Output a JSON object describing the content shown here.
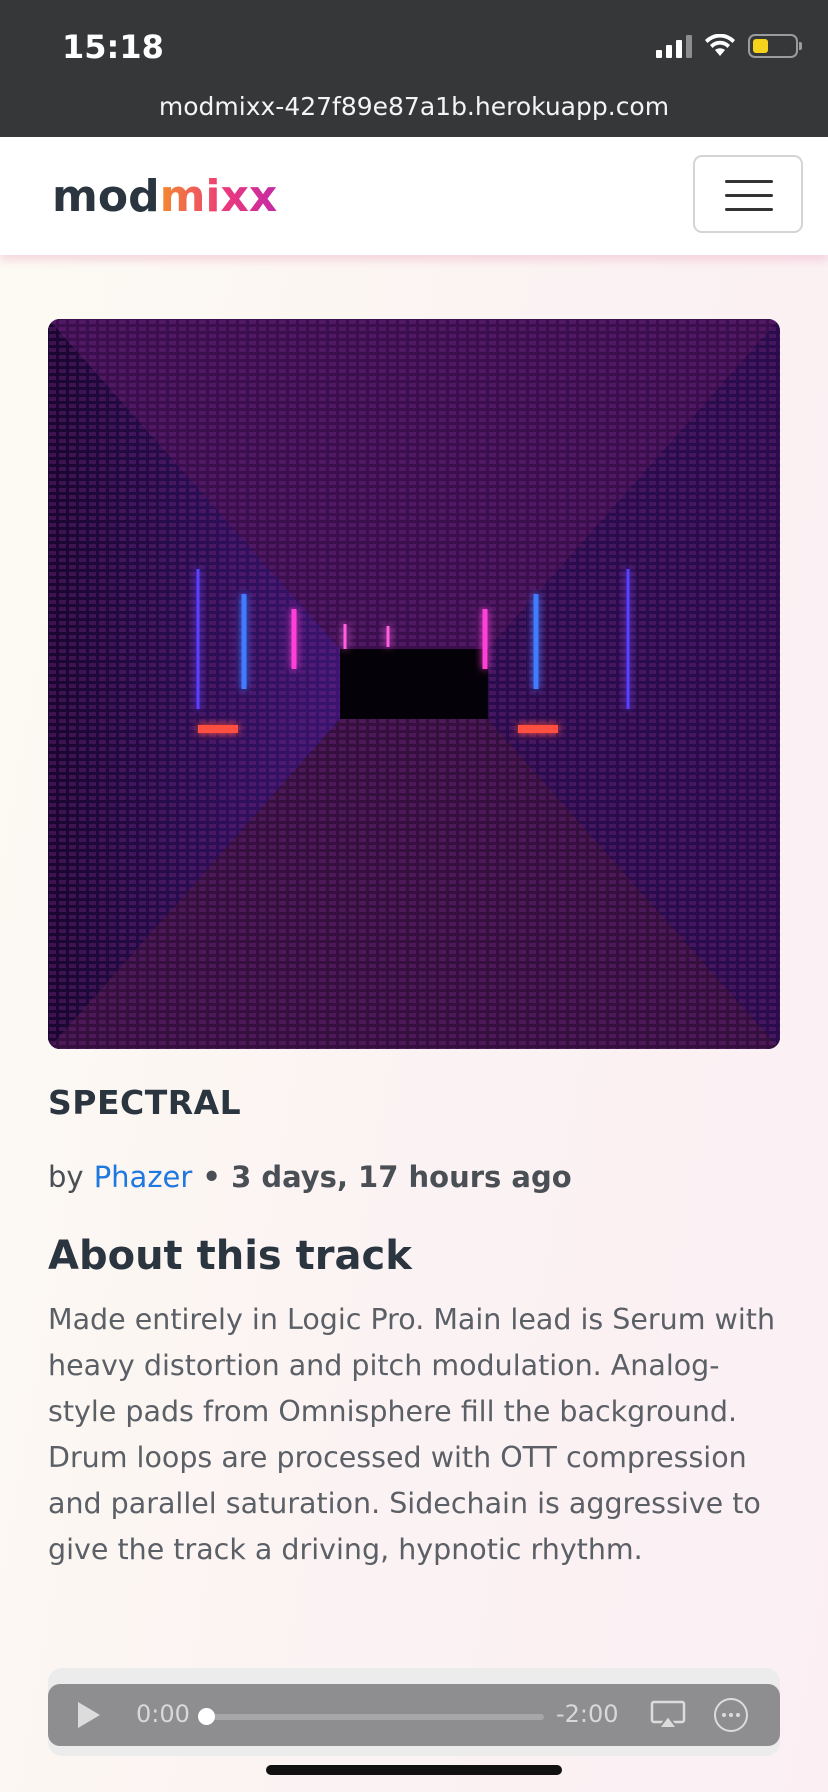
{
  "status_bar": {
    "time": "15:18",
    "url": "modmixx-427f89e87a1b.herokuapp.com"
  },
  "brand": {
    "part1": "mod",
    "part2": "mixx"
  },
  "track": {
    "title": "SPECTRAL",
    "by_label": "by",
    "artist": "Phazer",
    "separator": " • ",
    "posted": "3 days, 17 hours ago",
    "about_heading": "About this track",
    "description": "Made entirely in Logic Pro. Main lead is Serum with heavy distortion and pitch modulation. Analog-style pads from Omnisphere fill the background. Drum loops are processed with OTT compression and parallel saturation. Sidechain is aggressive to give the track a driving, hypnotic rhythm."
  },
  "player": {
    "current_time": "0:00",
    "remaining_time": "-2:00",
    "progress": 0
  },
  "icons": [
    "signal-icon",
    "wifi-icon",
    "battery-icon",
    "menu-icon",
    "play-icon",
    "airplay-icon",
    "more-icon"
  ],
  "colors": {
    "link": "#1f77e0",
    "brand_dark": "#2a3540",
    "statusbar": "#353739"
  }
}
